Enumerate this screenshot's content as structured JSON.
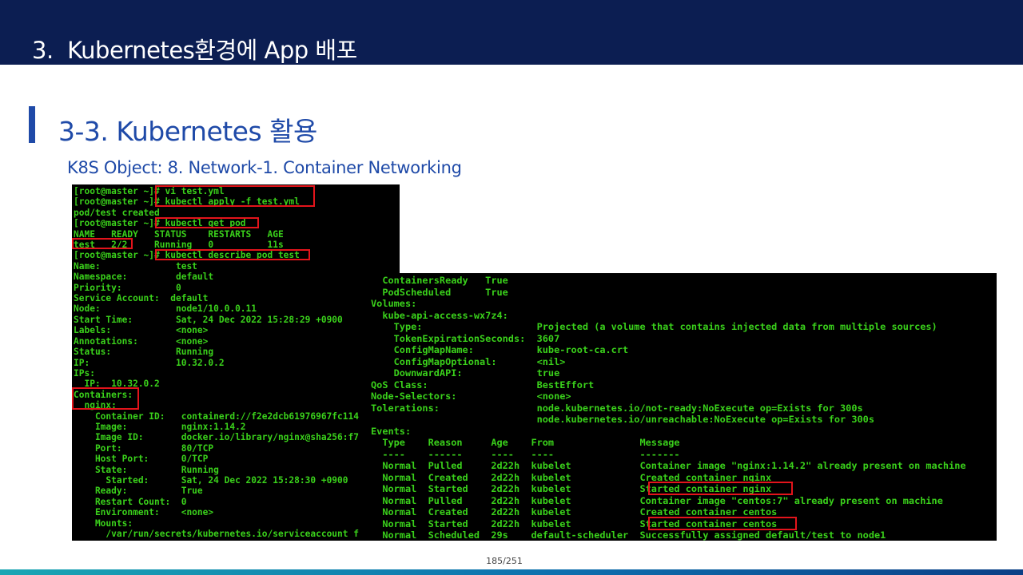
{
  "header": {
    "title": "3.  Kubernetes환경에 App 배포"
  },
  "section": {
    "title": "3-3. Kubernetes 활용"
  },
  "subtitle": "K8S Object: 8. Network-1. Container Networking",
  "terminal_left": {
    "lines": [
      "[root@master ~]# vi test.yml",
      "[root@master ~]# kubectl apply -f test.yml",
      "pod/test created",
      "[root@master ~]# kubectl get pod",
      "NAME   READY   STATUS    RESTARTS   AGE",
      "test   2/2     Running   0          11s",
      "[root@master ~]# kubectl describe pod test",
      "Name:              test",
      "Namespace:         default",
      "Priority:          0",
      "Service Account:  default",
      "Node:              node1/10.0.0.11",
      "Start Time:        Sat, 24 Dec 2022 15:28:29 +0900",
      "Labels:            <none>",
      "Annotations:       <none>",
      "Status:            Running",
      "IP:                10.32.0.2",
      "IPs:",
      "  IP:  10.32.0.2",
      "Containers:",
      "  nginx:",
      "    Container ID:   containerd://f2e2dcb61976967fc114",
      "    Image:          nginx:1.14.2",
      "    Image ID:       docker.io/library/nginx@sha256:f7",
      "    Port:           80/TCP",
      "    Host Port:      0/TCP",
      "    State:          Running",
      "      Started:      Sat, 24 Dec 2022 15:28:30 +0900",
      "    Ready:          True",
      "    Restart Count:  0",
      "    Environment:    <none>",
      "    Mounts:",
      "      /var/run/secrets/kubernetes.io/serviceaccount f"
    ]
  },
  "terminal_right": {
    "lines": [
      "  ContainersReady   True",
      "  PodScheduled      True",
      "Volumes:",
      "  kube-api-access-wx7z4:",
      "    Type:                    Projected (a volume that contains injected data from multiple sources)",
      "    TokenExpirationSeconds:  3607",
      "    ConfigMapName:           kube-root-ca.crt",
      "    ConfigMapOptional:       <nil>",
      "    DownwardAPI:             true",
      "QoS Class:                   BestEffort",
      "Node-Selectors:              <none>",
      "Tolerations:                 node.kubernetes.io/not-ready:NoExecute op=Exists for 300s",
      "                             node.kubernetes.io/unreachable:NoExecute op=Exists for 300s",
      "Events:",
      "  Type    Reason     Age    From               Message",
      "  ----    ------     ----   ----               -------",
      "  Normal  Pulled     2d22h  kubelet            Container image \"nginx:1.14.2\" already present on machine",
      "  Normal  Created    2d22h  kubelet            Created container nginx",
      "  Normal  Started    2d22h  kubelet            Started container nginx",
      "  Normal  Pulled     2d22h  kubelet            Container image \"centos:7\" already present on machine",
      "  Normal  Created    2d22h  kubelet            Created container centos",
      "  Normal  Started    2d22h  kubelet            Started container centos",
      "  Normal  Scheduled  29s    default-scheduler  Successfully assigned default/test to node1"
    ]
  },
  "footer": {
    "page": "185/251"
  },
  "colors": {
    "header_bg": "#0c1e52",
    "accent": "#1f4aa8",
    "terminal_text": "#3ad11b",
    "highlight": "#e3141b"
  }
}
